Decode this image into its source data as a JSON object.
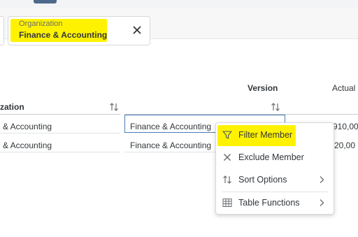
{
  "filter_bar": {
    "chip_label": "Organization",
    "chip_value": "Finance & Accounting"
  },
  "table": {
    "headers": {
      "version": "Version",
      "actual": "Actual",
      "organization_partial": "zation"
    },
    "rows": [
      {
        "org": "& Accounting",
        "version": "Finance & Accounting",
        "actual": "910,00"
      },
      {
        "org": "& Accounting",
        "version": "Finance & Accounting",
        "actual": "20,00"
      }
    ]
  },
  "context_menu": {
    "items": [
      {
        "label": "Filter Member",
        "icon": "filter-icon",
        "submenu": false
      },
      {
        "label": "Exclude Member",
        "icon": "close-icon",
        "submenu": false
      },
      {
        "label": "Sort Options",
        "icon": "sort-icon",
        "submenu": true
      },
      {
        "label": "Table Functions",
        "icon": "table-icon",
        "submenu": true
      }
    ]
  },
  "colors": {
    "highlight": "#fff200",
    "selection_border": "#4e7bb4",
    "text": "#32363a"
  }
}
